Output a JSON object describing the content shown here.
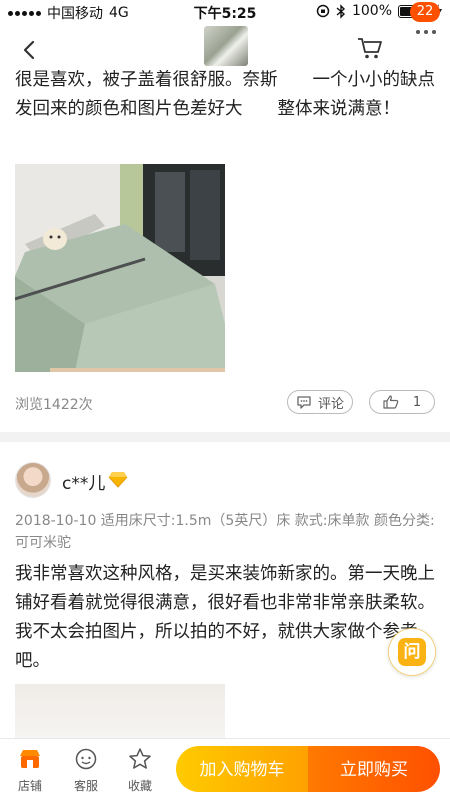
{
  "status_bar": {
    "carrier": "中国移动",
    "network": "4G",
    "time": "下午5:25",
    "battery_percent": "100%",
    "battery_level": 1.0
  },
  "nav": {
    "back_icon": "chevron-left-icon",
    "cart_icon": "cart-icon",
    "message_badge": "22"
  },
  "reviews": [
    {
      "text": "很是喜欢，被子盖着很舒服。奈斯　　一个小小的缺点　　发回来的颜色和图片色差好大　　整体来说满意！",
      "views": "浏览1422次",
      "comment_label": "评论",
      "like_count": "1"
    },
    {
      "username": "c**儿",
      "meta": "2018-10-10  适用床尺寸:1.5m（5英尺）床  款式:床单款  颜色分类:可可米驼",
      "text": "我非常喜欢这种风格，是买来装饰新家的。第一天晚上铺好看着就觉得很满意，很好看也非常非常亲肤柔软。我不太会拍图片，所以拍的不好，就供大家做个参考吧。"
    }
  ],
  "float_button": {
    "label": "问"
  },
  "bottom_bar": {
    "shop_label": "店铺",
    "service_label": "客服",
    "favorite_label": "收藏",
    "add_to_cart_label": "加入购物车",
    "buy_now_label": "立即购买"
  },
  "colors": {
    "accent_orange": "#ff5000",
    "cart_gradient_start": "#ffcb00",
    "cart_gradient_end": "#ffa100",
    "buy_gradient_start": "#ff7a00",
    "buy_gradient_end": "#ff5000",
    "diamond": "#f7b500"
  }
}
